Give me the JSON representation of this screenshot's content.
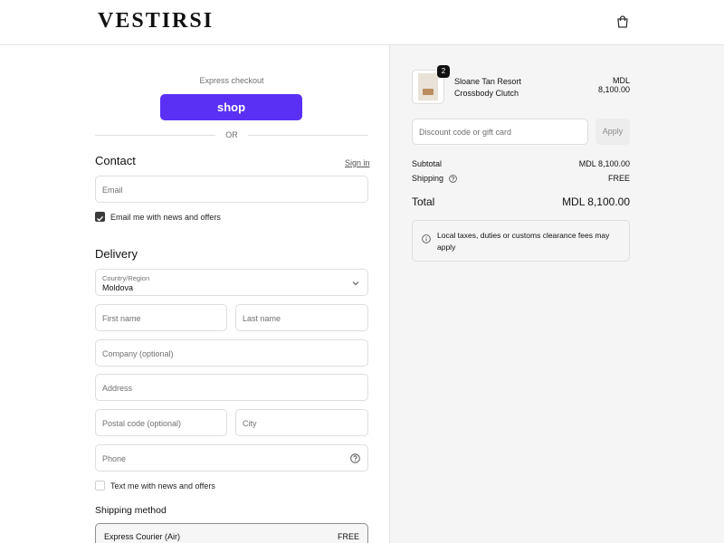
{
  "header": {
    "logo": "VESTIRSI",
    "cart_icon": "shopping-bag-icon"
  },
  "checkout": {
    "express_label": "Express checkout",
    "shop_pay_label": "shop",
    "shop_pay_color": "#5a31f4",
    "or_label": "OR",
    "contact": {
      "title": "Contact",
      "sign_in": "Sign in",
      "email_placeholder": "Email",
      "news_offers_label": "Email me with news and offers",
      "news_offers_checked": true
    },
    "delivery": {
      "title": "Delivery",
      "country_label": "Country/Region",
      "country_value": "Moldova",
      "first_name_placeholder": "First name",
      "last_name_placeholder": "Last name",
      "company_placeholder": "Company (optional)",
      "address_placeholder": "Address",
      "postal_placeholder": "Postal code (optional)",
      "city_placeholder": "City",
      "phone_placeholder": "Phone",
      "text_offers_label": "Text me with news and offers",
      "text_offers_checked": false
    },
    "shipping_method": {
      "title": "Shipping method",
      "option_name": "Express Courier (Air)",
      "option_price": "FREE"
    }
  },
  "summary": {
    "product": {
      "name": "Sloane Tan Resort Crossbody Clutch",
      "price": "MDL 8,100.00",
      "quantity": "2"
    },
    "discount_placeholder": "Discount code or gift card",
    "apply_label": "Apply",
    "subtotal_label": "Subtotal",
    "subtotal_value": "MDL 8,100.00",
    "shipping_label": "Shipping",
    "shipping_value": "FREE",
    "total_label": "Total",
    "total_value": "MDL 8,100.00",
    "tax_note": "Local taxes, duties or customs clearance fees may apply"
  }
}
